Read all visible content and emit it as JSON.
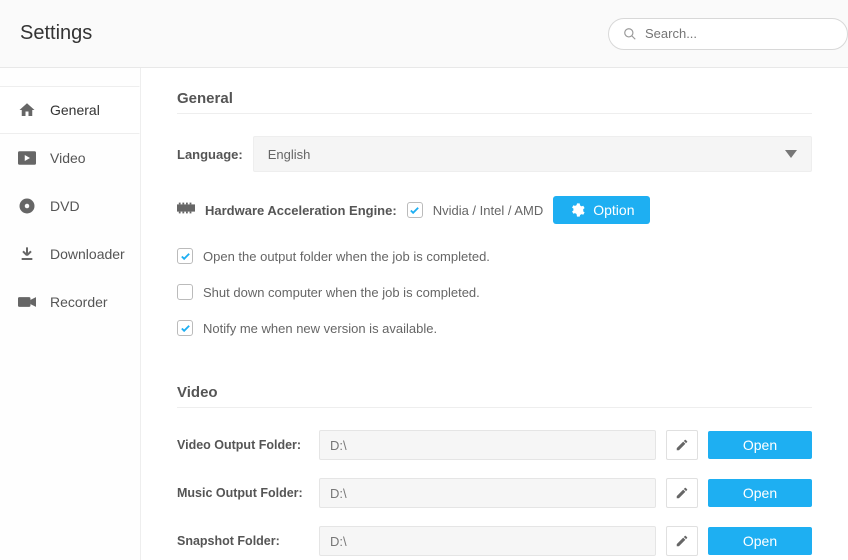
{
  "header": {
    "title": "Settings",
    "search_placeholder": "Search..."
  },
  "sidebar": {
    "items": [
      {
        "label": "General"
      },
      {
        "label": "Video"
      },
      {
        "label": "DVD"
      },
      {
        "label": "Downloader"
      },
      {
        "label": "Recorder"
      }
    ]
  },
  "general": {
    "section_title": "General",
    "language_label": "Language:",
    "language_value": "English",
    "hw_label": "Hardware Acceleration Engine:",
    "hw_value": "Nvidia / Intel / AMD",
    "hw_checked": true,
    "option_label": "Option",
    "open_output_label": "Open the output folder when the job is completed.",
    "open_output_checked": true,
    "shutdown_label": "Shut down computer when the job is completed.",
    "shutdown_checked": false,
    "notify_label": "Notify me when new version is available.",
    "notify_checked": true
  },
  "video": {
    "section_title": "Video",
    "rows": [
      {
        "label": "Video Output Folder:",
        "value": "D:\\",
        "open_label": "Open"
      },
      {
        "label": "Music Output Folder:",
        "value": "D:\\",
        "open_label": "Open"
      },
      {
        "label": "Snapshot Folder:",
        "value": "D:\\",
        "open_label": "Open"
      }
    ]
  }
}
